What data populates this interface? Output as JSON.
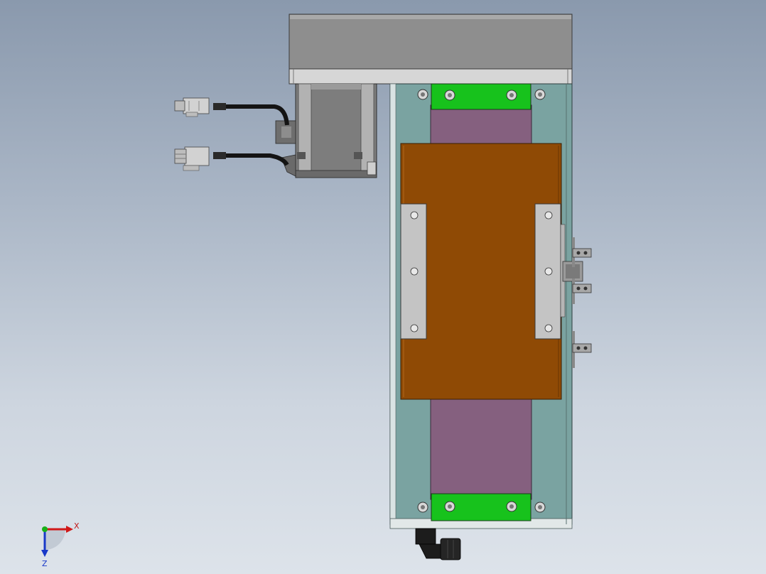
{
  "viewport": {
    "background_top": "#8a99ad",
    "background_bottom": "#dde3ea"
  },
  "model": {
    "colors": {
      "base_plate": "#7aa3a1",
      "motor_cover": "#8e8e8e",
      "carriage": "#8f4a05",
      "rail": "#85607f",
      "end_block": "#17c21c",
      "side_bracket": "#c4c4c4",
      "cable": "#141414",
      "connector": "#c8c8c8"
    }
  },
  "triad": {
    "x_label": "X",
    "z_label": "Z",
    "x_color": "#d01818",
    "y_color": "#18b018",
    "z_color": "#1838c8"
  }
}
